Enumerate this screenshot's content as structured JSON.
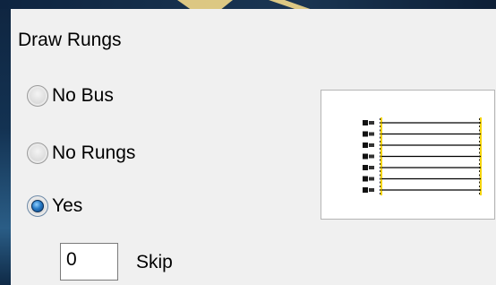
{
  "section": {
    "title": "Draw Rungs"
  },
  "options": [
    {
      "label": "No Bus",
      "checked": false
    },
    {
      "label": "No Rungs",
      "checked": false
    },
    {
      "label": "Yes",
      "checked": true
    }
  ],
  "skip": {
    "value": "0",
    "label": "Skip"
  },
  "preview": {
    "rung_count": 7,
    "rail_color": "#f5d400",
    "line_color": "#000000"
  },
  "colors": {
    "panel": "#f0f0f0",
    "background": "#10263f",
    "accent_ray": "#f2d889"
  }
}
